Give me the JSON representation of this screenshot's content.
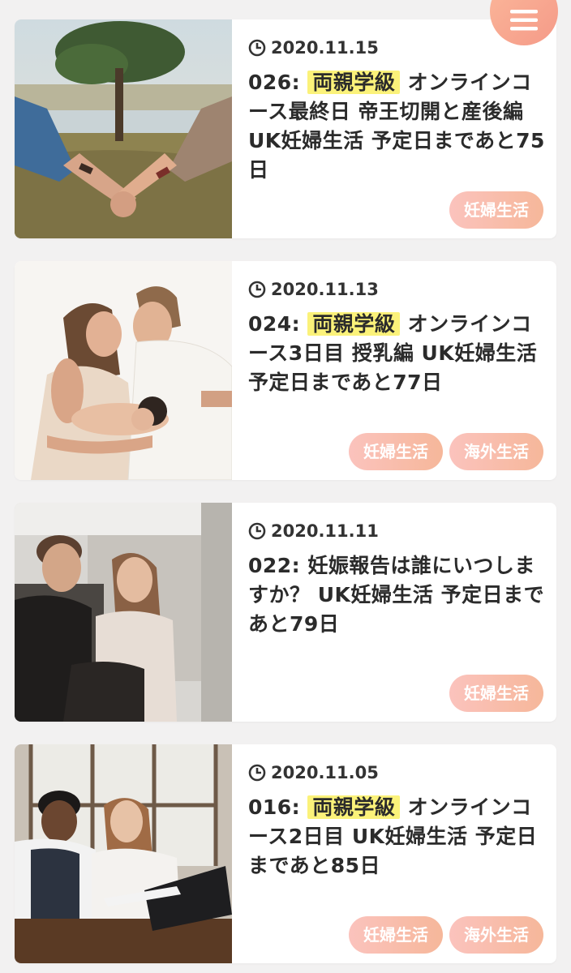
{
  "menu": {
    "icon": "hamburger-icon"
  },
  "posts": [
    {
      "date": "2020.11.15",
      "title_prefix": "026: ",
      "highlight": "両親学級",
      "title_rest": " オンラインコース最終日 帝王切開と産後編 UK妊婦生活 予定日まであと75日",
      "tags": [
        "妊婦生活"
      ],
      "image": "holding-hands-photo"
    },
    {
      "date": "2020.11.13",
      "title_prefix": "024: ",
      "highlight": "両親学級",
      "title_rest": " オンラインコース3日目 授乳編 UK妊婦生活 予定日まであと77日",
      "tags": [
        "妊婦生活",
        "海外生活"
      ],
      "image": "family-with-baby-photo"
    },
    {
      "date": "2020.11.11",
      "title_prefix": "022: 妊娠報告は誰にいつしますか？ UK妊婦生活 予定日まであと79日",
      "highlight": "",
      "title_rest": "",
      "tags": [
        "妊婦生活"
      ],
      "image": "couple-laughing-photo"
    },
    {
      "date": "2020.11.05",
      "title_prefix": "016: ",
      "highlight": "両親学級",
      "title_rest": " オンラインコース2日目 UK妊婦生活 予定日まであと85日",
      "tags": [
        "妊婦生活",
        "海外生活"
      ],
      "image": "couple-laptop-photo"
    }
  ],
  "colors": {
    "background": "#f2f1f1",
    "highlight": "#fbf27a",
    "tag_gradient_start": "#fbc3bd",
    "tag_gradient_end": "#f6b79a",
    "menu_button": "#f8a990"
  }
}
